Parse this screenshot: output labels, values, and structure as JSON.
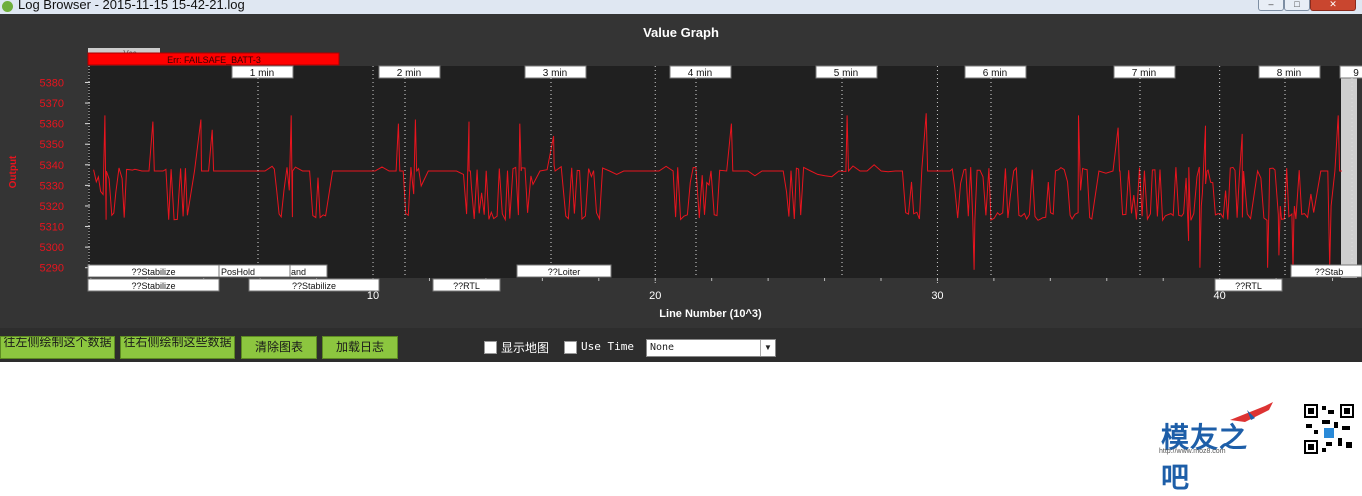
{
  "window": {
    "title": "Log Browser - 2015-11-15 15-42-21.log",
    "controls": [
      "minimize",
      "maximize",
      "close"
    ]
  },
  "graph": {
    "title": "Value Graph",
    "colors": {
      "background": "#343434",
      "plot": "#202020",
      "line": "#e8141e",
      "axis_text": "#e8141e",
      "label": "#ffffff"
    }
  },
  "chart_data": {
    "type": "line",
    "title": "Value Graph",
    "xlabel": "Line Number (10^3)",
    "ylabel": "Output",
    "xlim": [
      -0.1,
      44.3
    ],
    "ylim": [
      5285,
      5388
    ],
    "x_ticks": [
      "10",
      "20",
      "30",
      "40"
    ],
    "y_ticks": [
      "5380",
      "5370",
      "5360",
      "5350",
      "5340",
      "5330",
      "5320",
      "5310",
      "5300",
      "5290"
    ],
    "grid": "vertical dotted lines",
    "series": [
      {
        "values_note": "oscillating output signal, baseline ~5338 with spikes up to ~5364 and dips to ~5288",
        "color": "#e8141e"
      }
    ],
    "time_markers": [
      "1 min",
      "2 min",
      "3 min",
      "4 min",
      "5 min",
      "6 min",
      "7 min",
      "8 min",
      "9"
    ],
    "error_label": "Err: FAILSAFE_BATT-3",
    "mode_labels_top_row": [
      "??Stabilize",
      "PosHold",
      "and",
      "??Loiter",
      "??Stab"
    ],
    "mode_labels_bottom_row": [
      "??Stabilize",
      "??Stabilize",
      "??RTL",
      "??RTL"
    ],
    "ghost_label": "Vcc"
  },
  "toolbar": {
    "btn_left_axis": "往左侧绘制这个数据",
    "btn_right_axis": "往右侧绘制这些数据",
    "btn_clear": "清除图表",
    "btn_load": "加载日志",
    "show_map_label": "显示地图",
    "use_time_label": "Use Time",
    "series_select_value": "None"
  },
  "watermark": {
    "brand": "模友之吧",
    "url": "http://www.moz8.com"
  }
}
